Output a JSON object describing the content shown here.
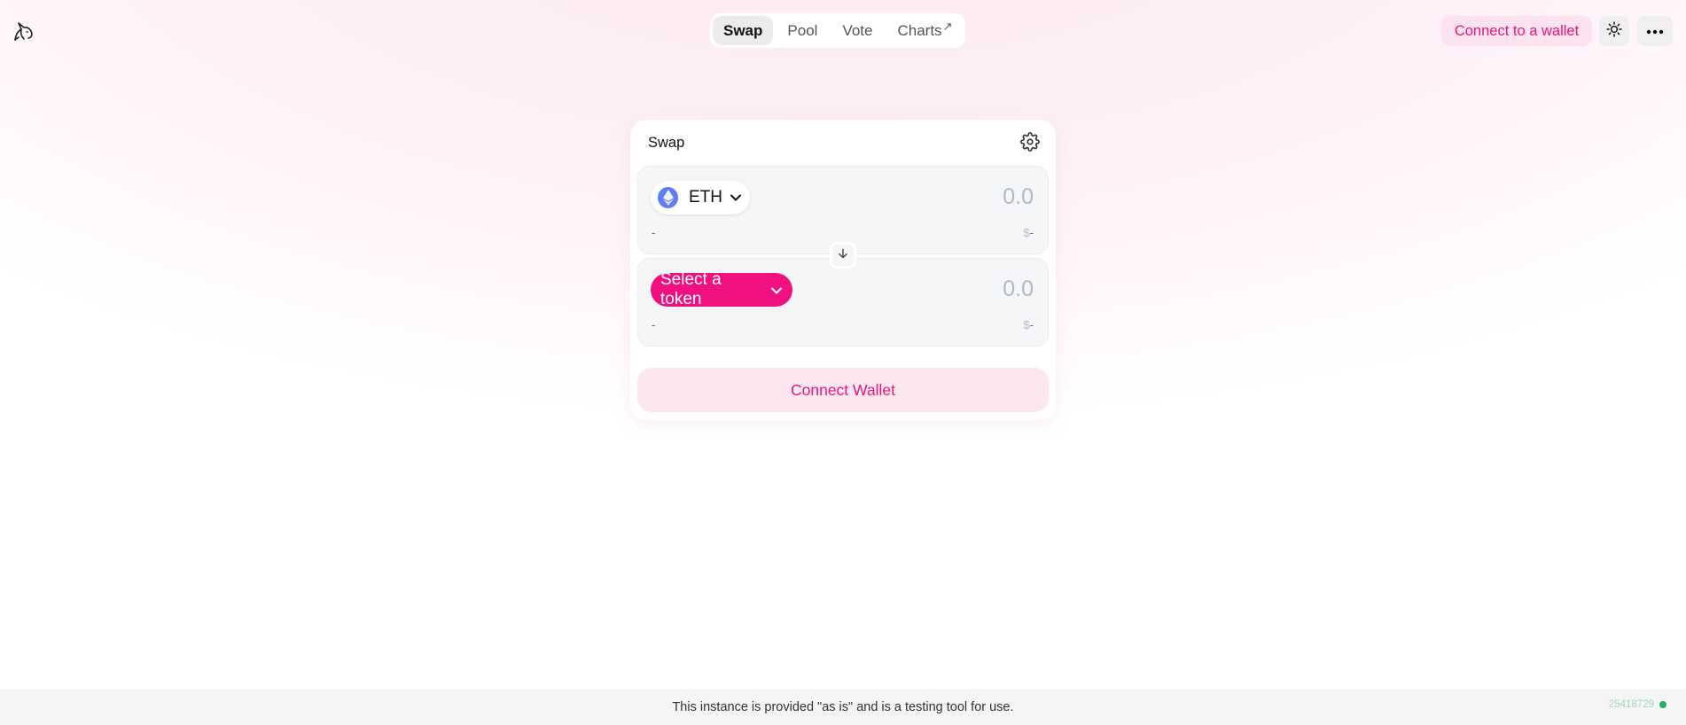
{
  "nav": {
    "items": [
      {
        "label": "Swap",
        "active": true
      },
      {
        "label": "Pool",
        "active": false
      },
      {
        "label": "Vote",
        "active": false
      },
      {
        "label": "Charts",
        "active": false,
        "external_mark": "↗"
      }
    ]
  },
  "header": {
    "connect_label": "Connect to a wallet",
    "theme_icon": "sun-icon",
    "more_icon": "ellipsis-icon",
    "logo_icon": "unicorn-logo-icon"
  },
  "swap": {
    "title": "Swap",
    "settings_icon": "gear-icon",
    "input": {
      "token_symbol": "ETH",
      "amount_placeholder": "0.0",
      "balance": "-",
      "usd_prefix": "$",
      "usd_value": "-"
    },
    "output": {
      "select_label": "Select a token",
      "amount_placeholder": "0.0",
      "balance": "-",
      "usd_prefix": "$",
      "usd_value": "-"
    },
    "connect_wallet_label": "Connect Wallet"
  },
  "footer": {
    "text": "This instance is provided \"as is\" and is a testing tool for use.",
    "block_number": "25418729"
  },
  "colors": {
    "accent": "#f0107f",
    "accent_soft": "#fde3ef",
    "eth": "#627eea",
    "status_ok": "#27ae60"
  }
}
